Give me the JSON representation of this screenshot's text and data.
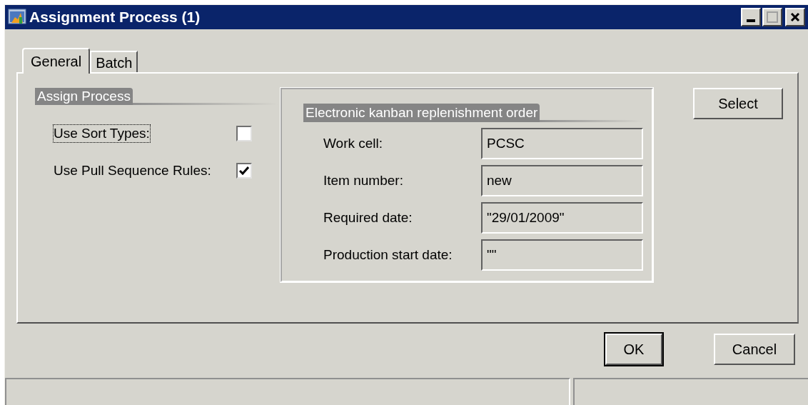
{
  "window": {
    "title": "Assignment Process (1)"
  },
  "tabs": [
    {
      "label": "General",
      "selected": true
    },
    {
      "label": "Batch",
      "selected": false
    }
  ],
  "assign_process": {
    "heading": "Assign Process",
    "options": [
      {
        "label": "Use Sort Types:",
        "checked": false,
        "focused": true
      },
      {
        "label": "Use Pull Sequence Rules:",
        "checked": true,
        "focused": false
      }
    ]
  },
  "kanban_order": {
    "heading": "Electronic kanban replenishment order",
    "fields": [
      {
        "label": "Work cell:",
        "value": "PCSC"
      },
      {
        "label": "Item number:",
        "value": "new"
      },
      {
        "label": "Required date:",
        "value": "\"29/01/2009\""
      },
      {
        "label": "Production start date:",
        "value": "\"\""
      }
    ]
  },
  "side_button": "Select",
  "buttons": [
    {
      "label": "OK",
      "default": true
    },
    {
      "label": "Cancel",
      "default": false
    }
  ]
}
